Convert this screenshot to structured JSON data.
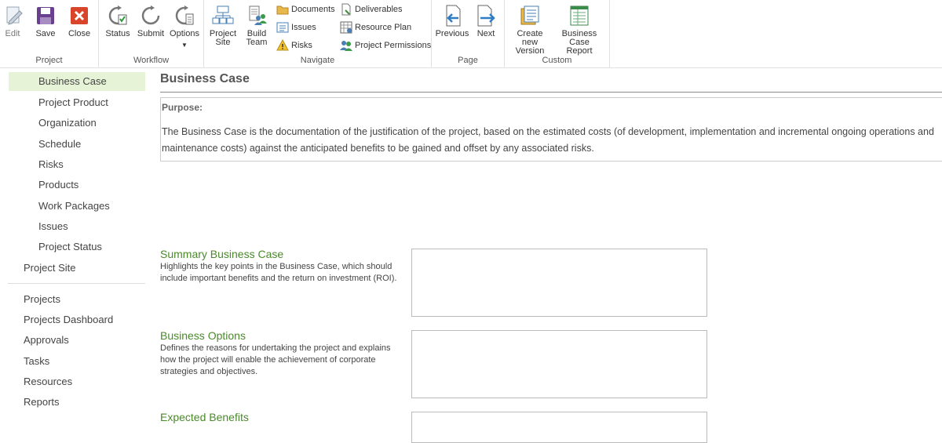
{
  "ribbon": {
    "project": {
      "label": "Project",
      "edit": "Edit",
      "save": "Save",
      "close": "Close"
    },
    "workflow": {
      "label": "Workflow",
      "status": "Status",
      "submit": "Submit",
      "options": "Options"
    },
    "navigate": {
      "label": "Navigate",
      "project_site_1": "Project",
      "project_site_2": "Site",
      "build_team_1": "Build",
      "build_team_2": "Team",
      "documents": "Documents",
      "issues": "Issues",
      "risks": "Risks",
      "deliverables": "Deliverables",
      "resource_plan": "Resource Plan",
      "project_permissions": "Project Permissions"
    },
    "page": {
      "label": "Page",
      "previous": "Previous",
      "next": "Next"
    },
    "custom": {
      "label": "Custom",
      "create_version_1": "Create new",
      "create_version_2": "Version",
      "bc_report_1": "Business Case",
      "bc_report_2": "Report"
    }
  },
  "nav": {
    "sub_items": [
      "Business Case",
      "Project Product",
      "Organization",
      "Schedule",
      "Risks",
      "Products",
      "Work Packages",
      "Issues",
      "Project Status"
    ],
    "project_site": "Project Site",
    "main_items": [
      "Projects",
      "Projects Dashboard",
      "Approvals",
      "Tasks",
      "Resources",
      "Reports"
    ]
  },
  "page": {
    "title": "Business Case",
    "purpose_label": "Purpose:",
    "purpose_text": "The Business Case is the documentation of the justification of the project, based on the estimated costs (of development, implementation and incremental ongoing operations and maintenance costs) against the anticipated benefits to be gained and offset by any associated risks."
  },
  "fields": [
    {
      "title": "Summary Business Case",
      "description": "Highlights the key points in the Business Case, which should include important benefits and the return on investment (ROI)."
    },
    {
      "title": "Business Options",
      "description": "Defines the reasons for undertaking the project and explains how the project will enable the achievement of corporate strategies and objectives."
    },
    {
      "title": "Expected Benefits",
      "description": ""
    }
  ],
  "colors": {
    "accent_green": "#4a8a2a",
    "selected_bg": "#e6f3d7",
    "close_red": "#d9452b",
    "save_purple": "#6b3f8f",
    "arrow_blue": "#2e7cc5"
  }
}
